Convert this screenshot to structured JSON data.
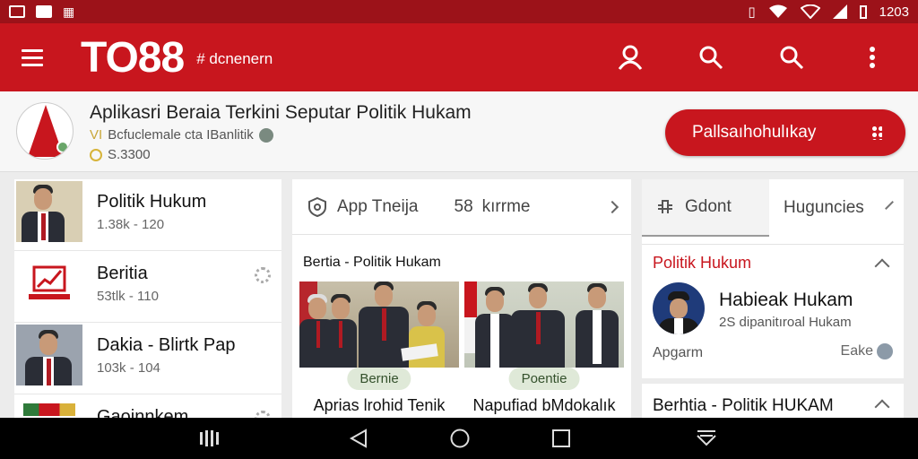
{
  "status_bar": {
    "time": "1203"
  },
  "app_bar": {
    "logo": "TO88",
    "subtitle": "# dcnenern"
  },
  "app_header": {
    "title": "Aplikasri Beraia Terkini Seputar Politik Hukam",
    "subtitle_prefix": "VI",
    "subtitle": "Bcfuclemale cta IBanlitik",
    "count": "S.3300",
    "install_button": "Pallsaıhohulıkay"
  },
  "left_list": {
    "items": [
      {
        "name": "Politik Hukum",
        "meta": "1.38k - 120"
      },
      {
        "name": "Beritia",
        "meta": "53tlk - 110"
      },
      {
        "name": "Dakia - Blirtk Pap",
        "meta": "103k - 104"
      },
      {
        "name": "Gaoinnkem",
        "meta": ""
      }
    ]
  },
  "middle_panel": {
    "tabs": [
      {
        "label": "App Tneija",
        "icon": "shield-icon"
      },
      {
        "label": "kırrme",
        "icon": "grid-icon",
        "icon_text": "58"
      }
    ],
    "section_title": "Bertia - Politik Hukam",
    "cards": [
      {
        "tag": "Bernie",
        "caption": "Aprias lrohid Tenik"
      },
      {
        "tag": "Poentie",
        "caption": "Napufiad bMdokalık"
      }
    ]
  },
  "right_panel": {
    "tabs": [
      {
        "label": "Gdont",
        "icon": "puzzle-icon"
      },
      {
        "label": "Huguncies"
      }
    ],
    "card": {
      "title": "Politik Hukum",
      "name": "Habieak Hukam",
      "sub": "2S dipanitıroal Hukam",
      "footer_left": "Apgarm",
      "footer_right": "Eake"
    },
    "card2_title": "Berhtia - Politik HUKAM"
  },
  "colors": {
    "primary": "#c8161e",
    "status_bar": "#9c1219",
    "tag_bg": "#dfe9d8"
  }
}
